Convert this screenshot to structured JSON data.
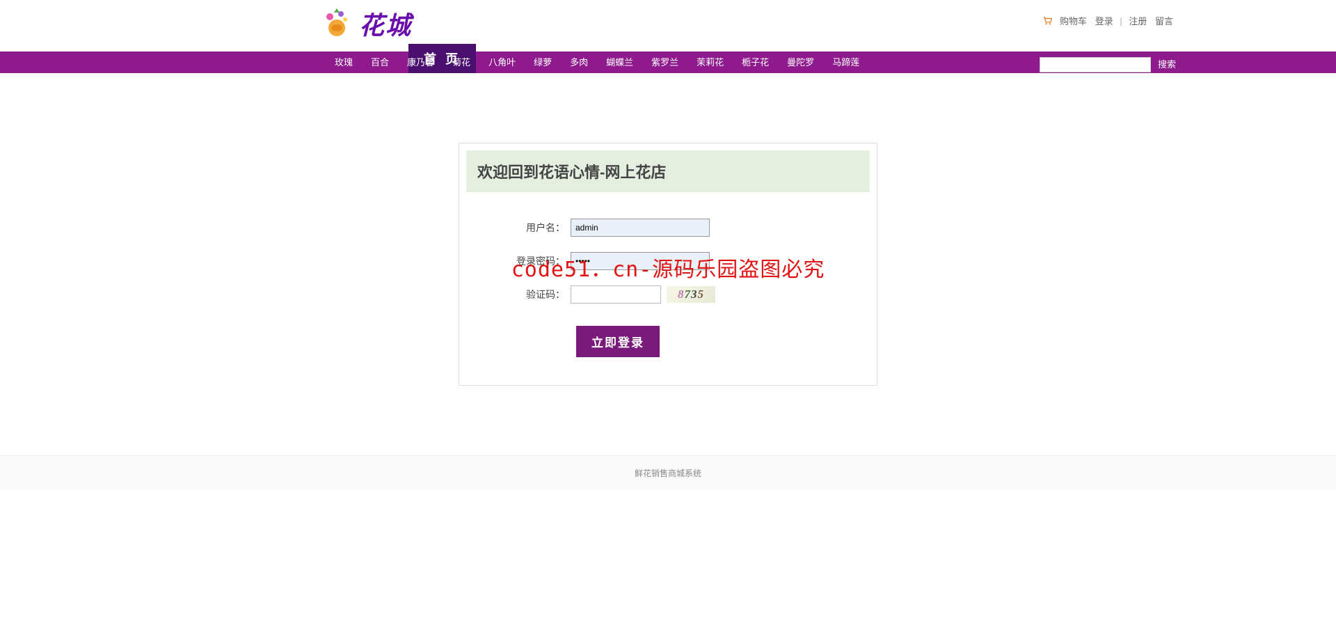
{
  "header": {
    "logo_text": "花城",
    "top_links": {
      "cart": "购物车",
      "login": "登录",
      "register": "注册",
      "message": "留言",
      "separator": "|"
    },
    "home_tab": "首 页"
  },
  "nav": {
    "items": [
      "玫瑰",
      "百合",
      "康乃馨",
      "菊花",
      "八角叶",
      "绿萝",
      "多肉",
      "蝴蝶兰",
      "紫罗兰",
      "茉莉花",
      "栀子花",
      "曼陀罗",
      "马蹄莲"
    ],
    "search_placeholder": "",
    "search_button": "搜索"
  },
  "login": {
    "title": "欢迎回到花语心情-网上花店",
    "username_label": "用户名：",
    "username_value": "admin",
    "password_label": "登录密码：",
    "password_value": "•••••",
    "captcha_label": "验证码：",
    "captcha_value": "",
    "captcha_code": "8735",
    "submit": "立即登录"
  },
  "watermark": "code51．cn-源码乐园盗图必究",
  "footer": "鲜花销售商城系统"
}
